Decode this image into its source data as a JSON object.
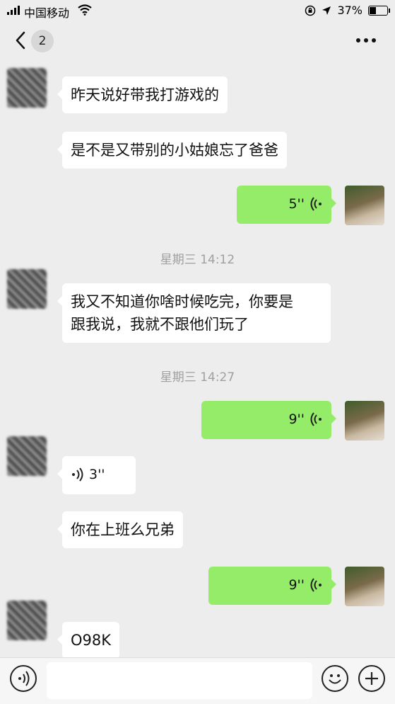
{
  "status_bar": {
    "carrier": "中国移动",
    "battery": "37%",
    "battery_level": 0.37
  },
  "nav": {
    "unread_count": "2"
  },
  "messages": [
    {
      "side": "left",
      "type": "text",
      "text": "昨天说好带我打游戏的"
    },
    {
      "side": "left",
      "type": "text",
      "text": "是不是又带别的小姑娘忘了爸爸"
    },
    {
      "side": "right",
      "type": "voice",
      "duration": "5''"
    },
    {
      "type": "time",
      "text": "星期三 14:12"
    },
    {
      "side": "left",
      "type": "text",
      "line1": "我又不知道你啥时候吃完，你要是",
      "line2": "跟我说，我就不跟他们玩了"
    },
    {
      "type": "time",
      "text": "星期三 14:27"
    },
    {
      "side": "right",
      "type": "voice",
      "duration": "9''"
    },
    {
      "side": "left",
      "type": "voice",
      "duration": "3''"
    },
    {
      "side": "left",
      "type": "text",
      "text": "你在上班么兄弟"
    },
    {
      "side": "right",
      "type": "voice",
      "duration": "9''"
    },
    {
      "side": "left",
      "type": "text",
      "text": "O98K"
    }
  ],
  "icons": {
    "back": "chevron-left",
    "more": "ellipsis",
    "voice_wave": "sound-wave",
    "voice_input": "voice",
    "emoji": "smiley",
    "plus": "plus"
  },
  "colors": {
    "background": "#ededed",
    "my_bubble": "#95ec69",
    "their_bubble": "#ffffff"
  }
}
